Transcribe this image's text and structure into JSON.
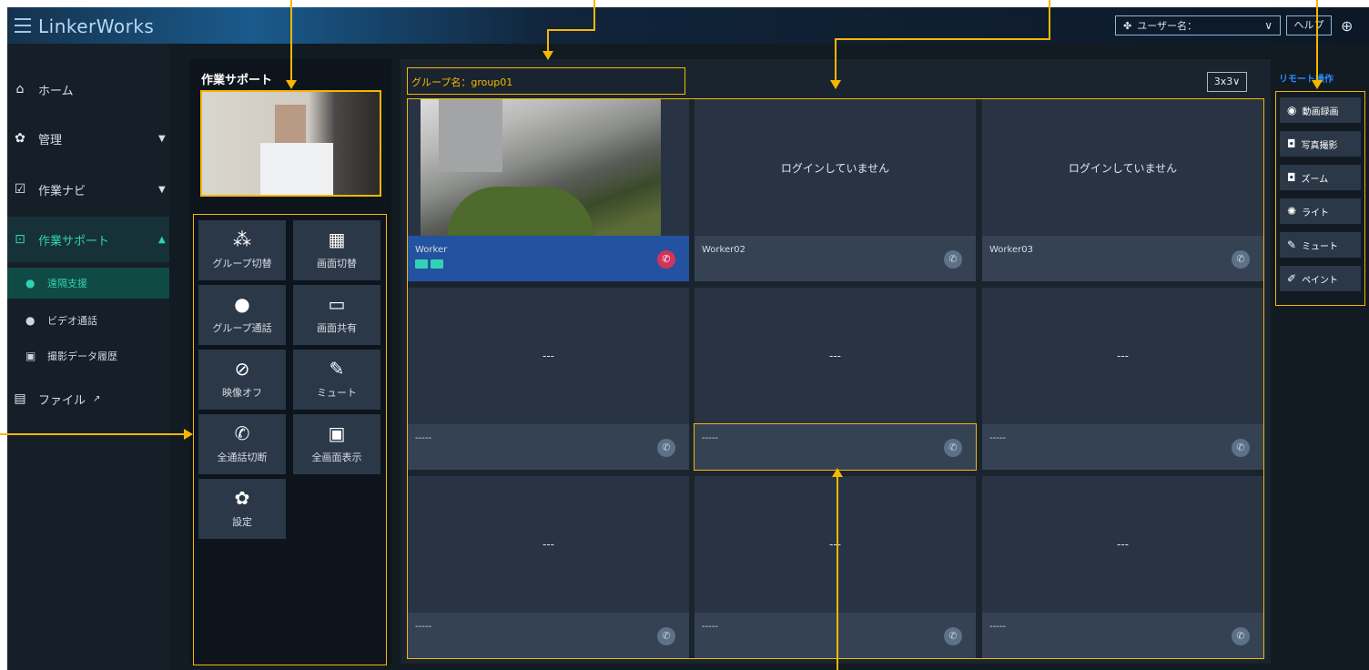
{
  "app": {
    "title": "LinkerWorks"
  },
  "header": {
    "user_label": "ユーザー名：",
    "help_label": "ヘルプ"
  },
  "sidebar": {
    "items": [
      {
        "label": "ホーム",
        "icon": "home-icon"
      },
      {
        "label": "管理",
        "icon": "gear-icon"
      },
      {
        "label": "作業ナビ",
        "icon": "checkbox-icon"
      },
      {
        "label": "作業サポート",
        "icon": "chat-icon"
      },
      {
        "label": "ファイル",
        "icon": "file-icon"
      }
    ],
    "sub_items": [
      {
        "label": "遠隔支援"
      },
      {
        "label": "ビデオ通話"
      },
      {
        "label": "撮影データ履歴"
      }
    ]
  },
  "tool_panel": {
    "title": "作業サポート",
    "buttons": [
      {
        "label": "グループ切替",
        "icon": "group-switch-icon"
      },
      {
        "label": "画面切替",
        "icon": "screen-switch-icon"
      },
      {
        "label": "グループ通話",
        "icon": "group-call-icon"
      },
      {
        "label": "画面共有",
        "icon": "monitor-icon"
      },
      {
        "label": "映像オフ",
        "icon": "video-off-icon"
      },
      {
        "label": "ミュート",
        "icon": "mic-mute-icon"
      },
      {
        "label": "全通話切断",
        "icon": "hangup-all-icon"
      },
      {
        "label": "全画面表示",
        "icon": "fullscreen-icon"
      },
      {
        "label": "設定",
        "icon": "gear-icon"
      }
    ]
  },
  "main": {
    "group_name": "グループ名：group01",
    "layout_value": "3x3",
    "cells": [
      {
        "worker": "Worker",
        "message": "",
        "state": "active"
      },
      {
        "worker": "Worker02",
        "message": "ログインしていません",
        "state": "offline"
      },
      {
        "worker": "Worker03",
        "message": "ログインしていません",
        "state": "offline"
      },
      {
        "worker": "-----",
        "message": "---",
        "state": "empty"
      },
      {
        "worker": "-----",
        "message": "---",
        "state": "empty"
      },
      {
        "worker": "-----",
        "message": "---",
        "state": "empty"
      },
      {
        "worker": "-----",
        "message": "---",
        "state": "empty"
      },
      {
        "worker": "-----",
        "message": "---",
        "state": "empty"
      },
      {
        "worker": "-----",
        "message": "---",
        "state": "empty"
      }
    ]
  },
  "remote": {
    "title": "リモート操作",
    "buttons": [
      {
        "label": "動画録画",
        "icon": "record-icon"
      },
      {
        "label": "写真撮影",
        "icon": "camera-icon"
      },
      {
        "label": "ズーム",
        "icon": "zoom-camera-icon"
      },
      {
        "label": "ライト",
        "icon": "light-icon"
      },
      {
        "label": "ミュート",
        "icon": "mic-mute-icon"
      },
      {
        "label": "ペイント",
        "icon": "pen-icon"
      }
    ]
  },
  "colors": {
    "accent_teal": "#31d2b4",
    "annotation_yellow": "#f6b700",
    "active_blue": "#2352a0",
    "hangup_red": "#d1345b"
  }
}
